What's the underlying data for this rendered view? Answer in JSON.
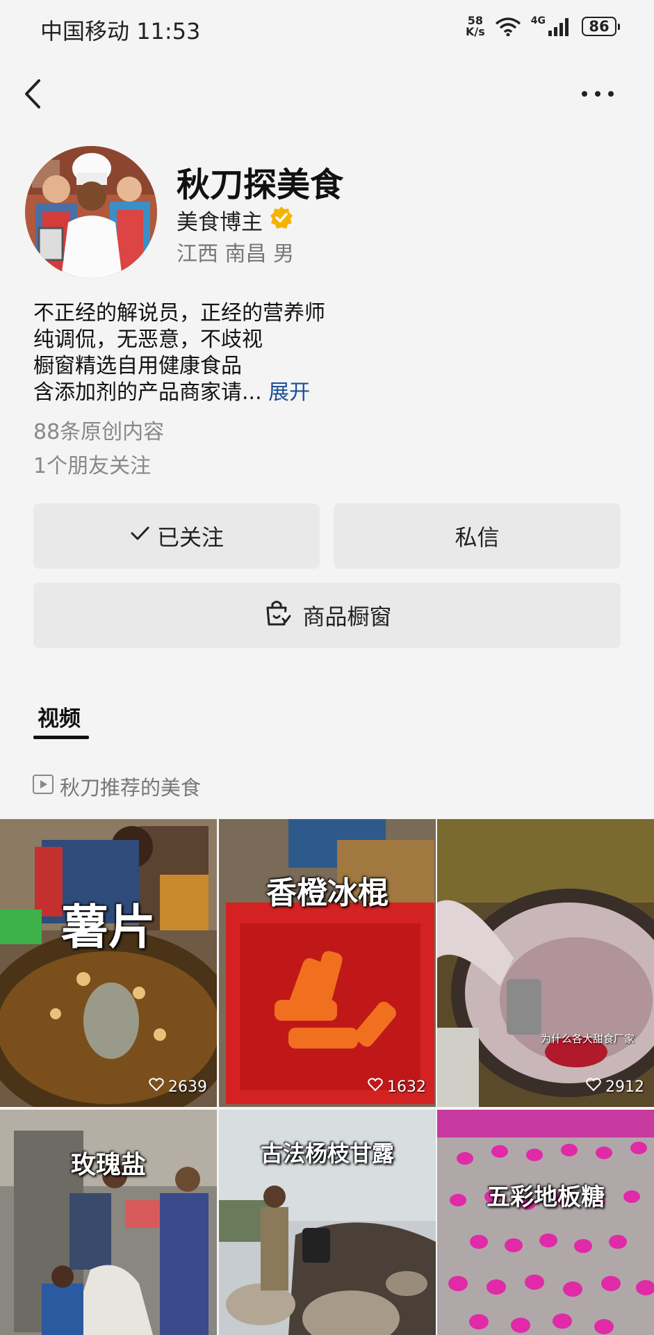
{
  "status_bar": {
    "carrier": "中国移动",
    "time": "11:53",
    "net_speed_value": "58",
    "net_speed_unit": "K/s",
    "network_type": "4G",
    "battery": "86"
  },
  "nav": {
    "back_icon": "chevron-left-icon",
    "more_icon": "more-dots-icon"
  },
  "profile": {
    "name": "秋刀探美食",
    "tag": "美食博主",
    "verified_color": "#f5b300",
    "location": "江西 南昌 男",
    "bio_lines": [
      "不正经的解说员，正经的营养师",
      "纯调侃，无恶意，不歧视",
      "橱窗精选自用健康食品",
      "含添加剂的产品商家请..."
    ],
    "bio_expand": "展开",
    "original_count": "88条原创内容",
    "friends_following": "1个朋友关注"
  },
  "actions": {
    "follow_label": "已关注",
    "message_label": "私信",
    "shop_label": "商品橱窗"
  },
  "tabs": {
    "video_label": "视频"
  },
  "collection": {
    "label": "秋刀推荐的美食"
  },
  "videos": [
    {
      "title": "薯片",
      "likes": "2639",
      "caption": ""
    },
    {
      "title": "香橙冰棍",
      "likes": "1632",
      "caption": ""
    },
    {
      "title": "",
      "likes": "2912",
      "caption": "为什么各大甜食厂家"
    },
    {
      "title": "玫瑰盐",
      "likes": "",
      "caption": ""
    },
    {
      "title": "古法杨枝甘露",
      "likes": "",
      "caption": ""
    },
    {
      "title": "五彩地板糖",
      "likes": "",
      "caption": ""
    }
  ]
}
